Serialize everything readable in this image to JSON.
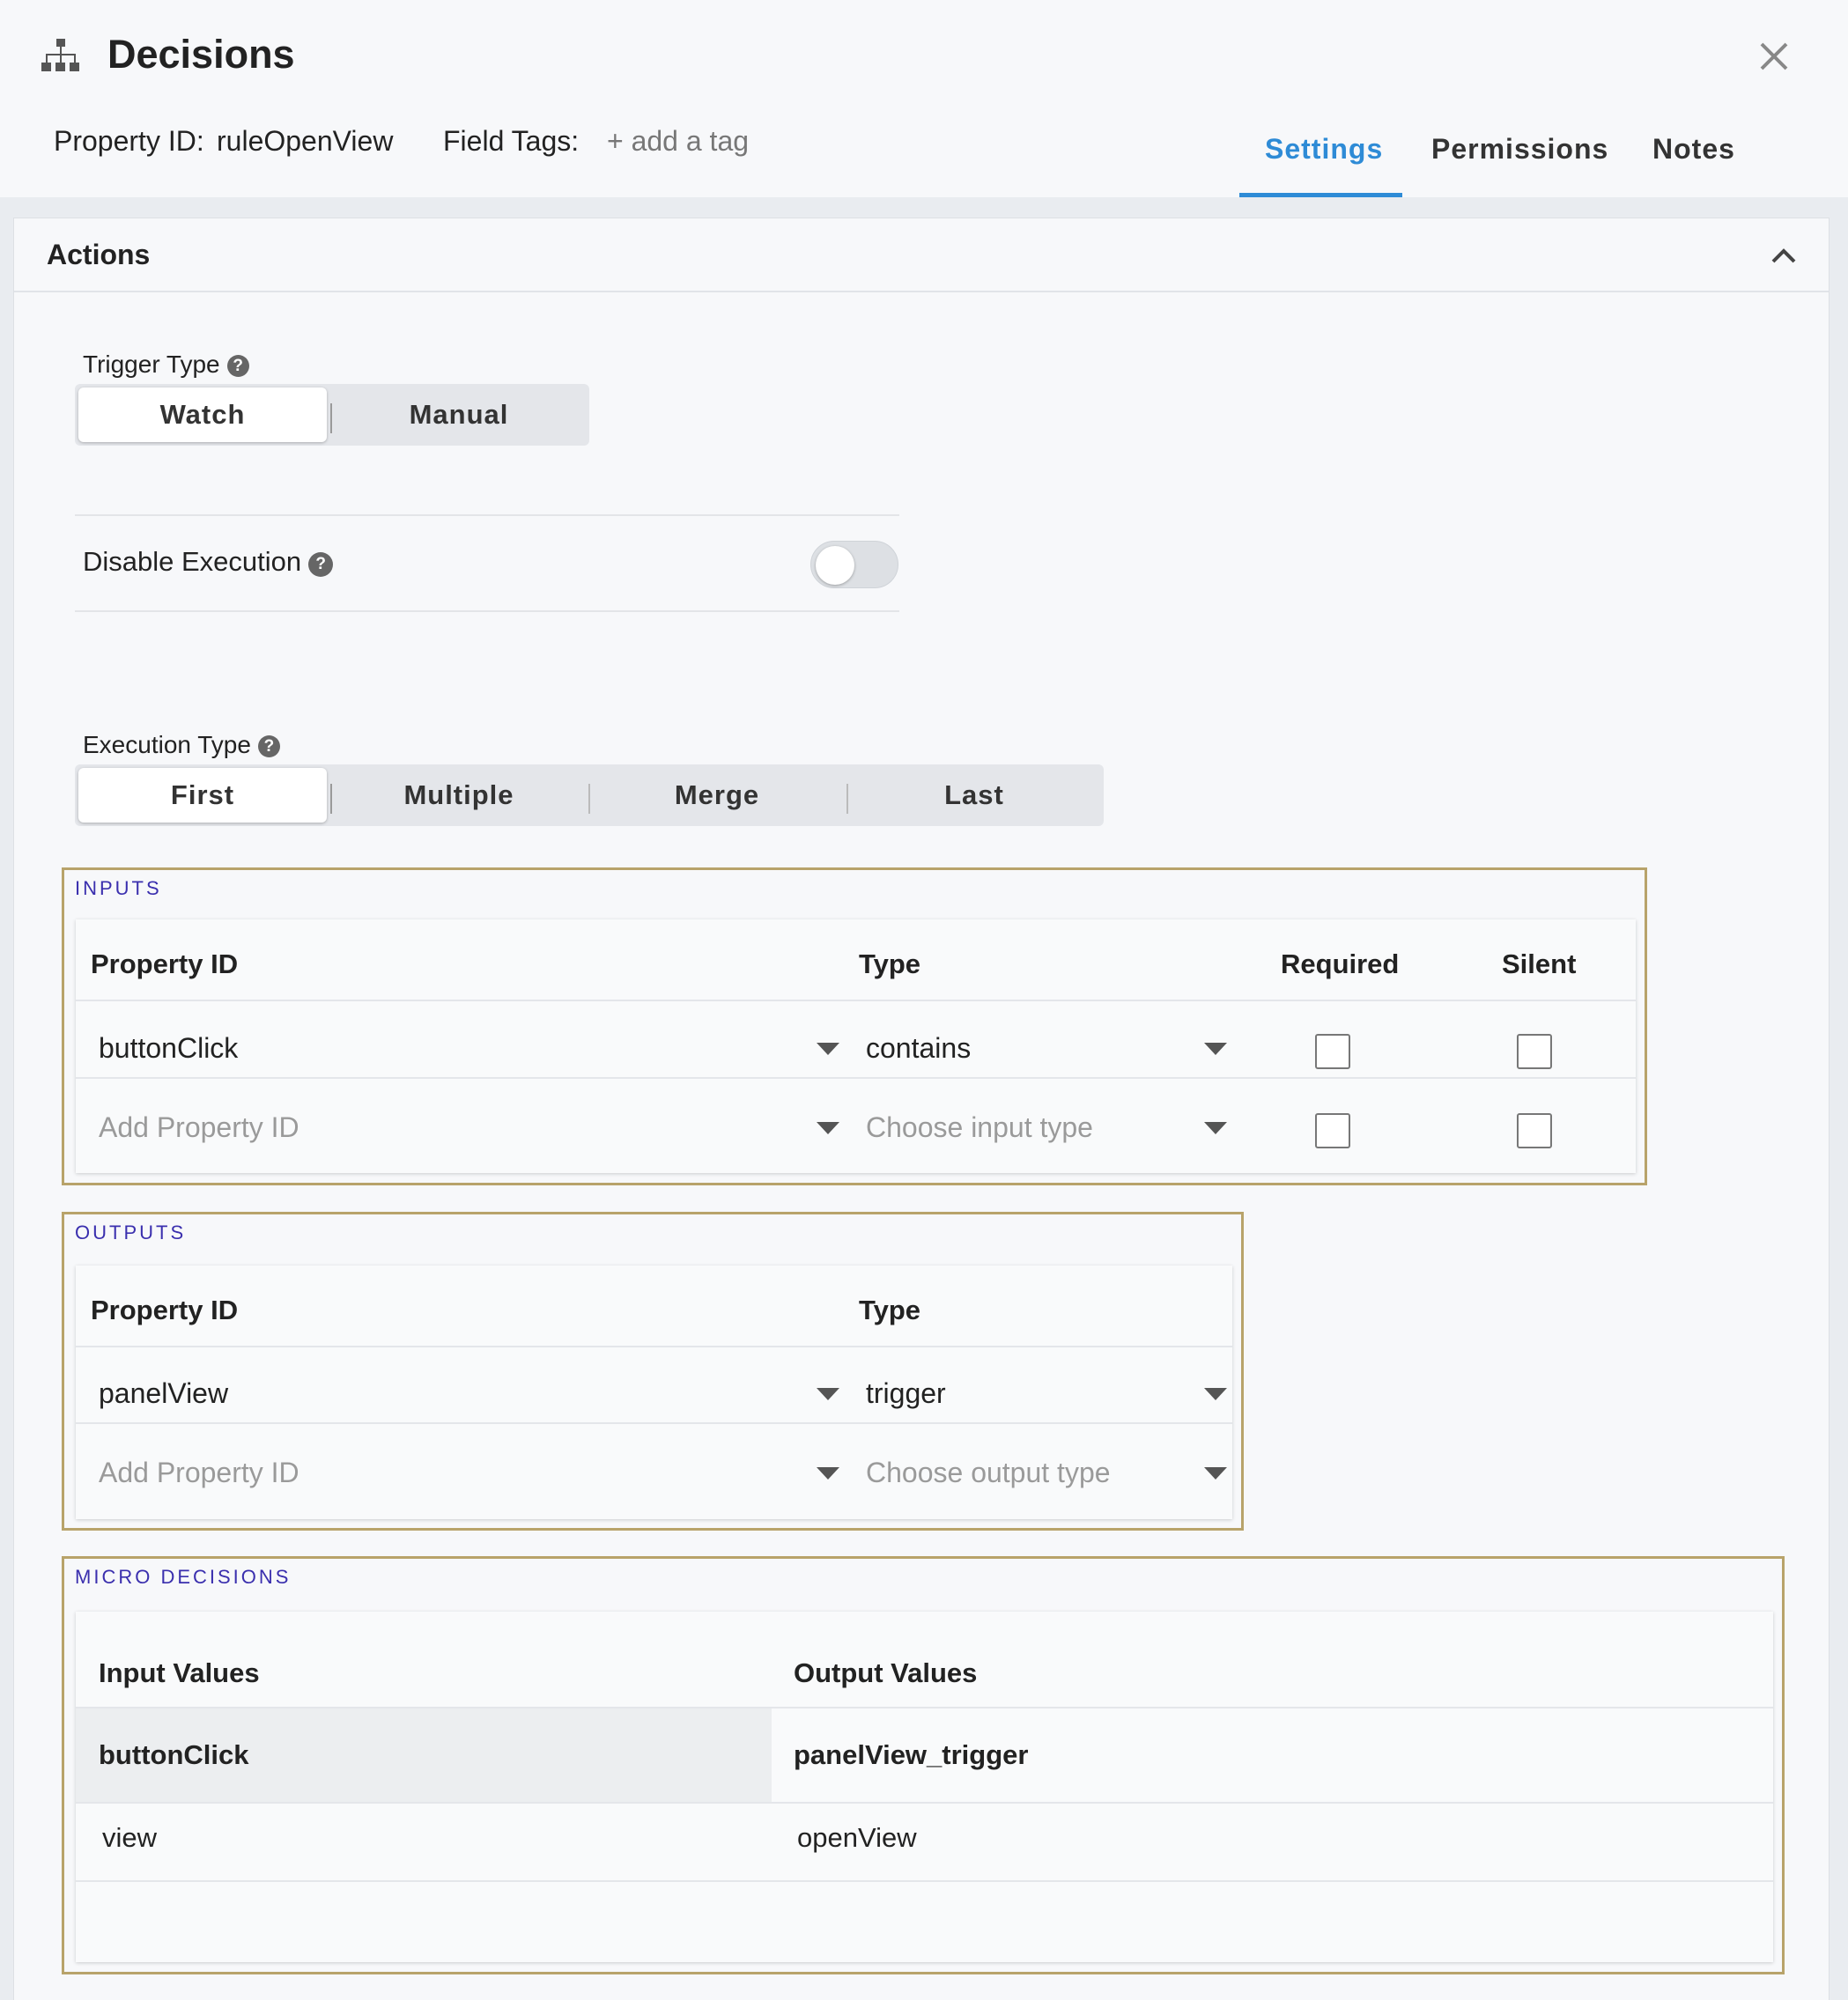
{
  "header": {
    "title": "Decisions",
    "icon": "hierarchy-icon",
    "property_id_label": "Property ID:",
    "property_id_value": "ruleOpenView",
    "field_tags_label": "Field Tags:",
    "add_tag_placeholder": "+ add a tag",
    "tabs": [
      {
        "label": "Settings",
        "active": true
      },
      {
        "label": "Permissions",
        "active": false
      },
      {
        "label": "Notes",
        "active": false
      }
    ],
    "accent_color": "#2e8bd6"
  },
  "panel": {
    "title": "Actions",
    "trigger_type": {
      "label": "Trigger Type",
      "options": [
        "Watch",
        "Manual"
      ],
      "selected": "Watch"
    },
    "disable_execution": {
      "label": "Disable Execution",
      "enabled": false
    },
    "execution_type": {
      "label": "Execution Type",
      "options": [
        "First",
        "Multiple",
        "Merge",
        "Last"
      ],
      "selected": "First"
    }
  },
  "inputs": {
    "section_title": "INPUTS",
    "headers": [
      "Property ID",
      "Type",
      "Required",
      "Silent"
    ],
    "rows": [
      {
        "property_id": "buttonClick",
        "type": "contains",
        "required": false,
        "silent": false
      },
      {
        "property_id_placeholder": "Add Property ID",
        "type_placeholder": "Choose input type",
        "required": false,
        "silent": false
      }
    ]
  },
  "outputs": {
    "section_title": "OUTPUTS",
    "headers": [
      "Property ID",
      "Type"
    ],
    "rows": [
      {
        "property_id": "panelView",
        "type": "trigger"
      },
      {
        "property_id_placeholder": "Add Property ID",
        "type_placeholder": "Choose output type"
      }
    ]
  },
  "micro_decisions": {
    "section_title": "MICRO DECISIONS",
    "headers": [
      "Input Values",
      "Output Values"
    ],
    "group_row": {
      "input": "buttonClick",
      "output": "panelView_trigger"
    },
    "rows": [
      {
        "input": "view",
        "output": "openView"
      }
    ]
  },
  "section_border_color": "#b8a36a",
  "section_title_color": "#3a2fae"
}
